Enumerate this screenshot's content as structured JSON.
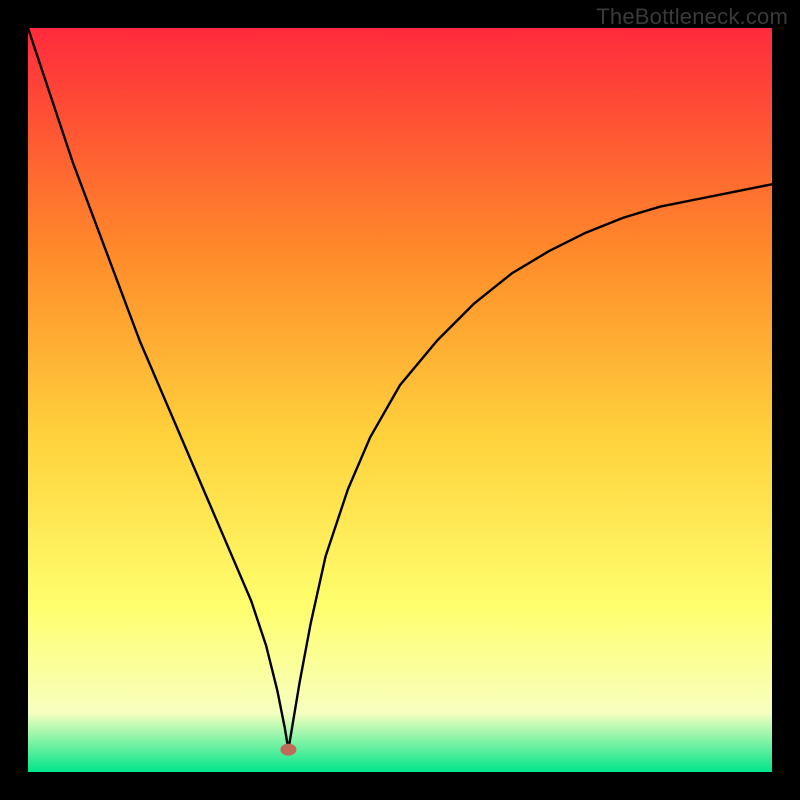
{
  "watermark": "TheBottleneck.com",
  "colors": {
    "frame": "#000000",
    "grad_top": "#ff2a3c",
    "grad_mid1": "#ff8a2a",
    "grad_mid2": "#ffd23c",
    "grad_mid3": "#ffff6e",
    "grad_mid4": "#f7ffbf",
    "grad_bottom": "#00e58a",
    "curve": "#000000",
    "marker": "#c06a5a"
  },
  "chart_data": {
    "type": "line",
    "title": "",
    "xlabel": "",
    "ylabel": "",
    "xlim": [
      0,
      100
    ],
    "ylim": [
      0,
      100
    ],
    "marker": {
      "x": 35,
      "y": 3
    },
    "series": [
      {
        "name": "curve",
        "x": [
          0,
          3,
          6,
          9,
          12,
          15,
          18,
          21,
          24,
          27,
          30,
          32,
          33.5,
          34.5,
          35,
          35.5,
          36.5,
          38,
          40,
          43,
          46,
          50,
          55,
          60,
          65,
          70,
          75,
          80,
          85,
          90,
          95,
          100
        ],
        "y": [
          100,
          91,
          82,
          74,
          66,
          58,
          51,
          44,
          37,
          30,
          23,
          17,
          11,
          6,
          3,
          6,
          12,
          20,
          29,
          38,
          45,
          52,
          58,
          63,
          67,
          70,
          72.5,
          74.5,
          76,
          77,
          78,
          79
        ]
      }
    ]
  }
}
